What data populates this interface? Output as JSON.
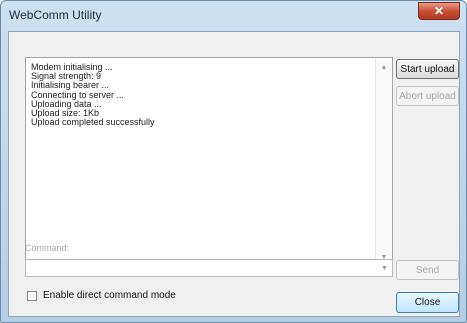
{
  "window": {
    "title": "WebComm Utility"
  },
  "log": {
    "lines": [
      "Modem initialising ...",
      "Signal strength: 9",
      "Initialising bearer ...",
      "Connecting to server ...",
      "Uploading data ...",
      "Upload size: 1Kb",
      "Upload completed successfully"
    ]
  },
  "buttons": {
    "start_upload": "Start upload",
    "abort_upload": "Abort upload",
    "send": "Send",
    "close": "Close"
  },
  "command": {
    "label": "Command:",
    "value": ""
  },
  "options": {
    "direct_mode_label": "Enable direct command mode",
    "direct_mode_checked": false
  },
  "icons": {
    "close": "close-icon",
    "scroll_up": "scroll-up-icon",
    "scroll_down": "scroll-down-icon",
    "combo_arrow": "chevron-down-icon"
  }
}
